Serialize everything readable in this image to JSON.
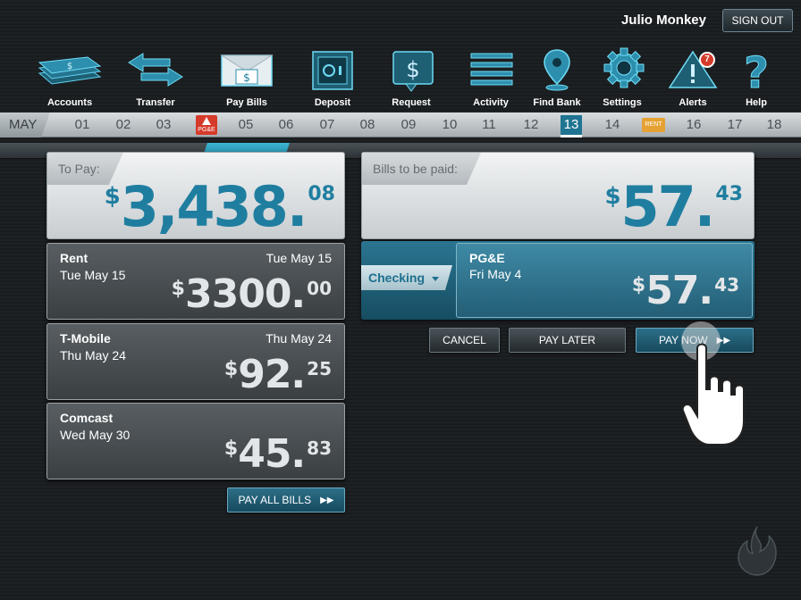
{
  "header": {
    "user_name": "Julio Monkey",
    "sign_out_label": "SIGN OUT"
  },
  "nav": {
    "items": [
      {
        "label": "Accounts",
        "icon": "money-stack-icon"
      },
      {
        "label": "Transfer",
        "icon": "transfer-arrows-icon"
      },
      {
        "label": "Pay Bills",
        "icon": "envelope-dollar-icon",
        "active": true
      },
      {
        "label": "Deposit",
        "icon": "safe-icon"
      },
      {
        "label": "Request",
        "icon": "dollar-bubble-icon"
      },
      {
        "label": "Activity",
        "icon": "list-lines-icon"
      },
      {
        "label": "Find Bank",
        "icon": "map-pin-icon"
      },
      {
        "label": "Settings",
        "icon": "gear-icon"
      },
      {
        "label": "Alerts",
        "icon": "alert-triangle-icon",
        "badge": "7"
      },
      {
        "label": "Help",
        "icon": "question-mark-icon"
      }
    ]
  },
  "calendar": {
    "month": "MAY",
    "dates": [
      "01",
      "02",
      "03",
      "04",
      "05",
      "06",
      "07",
      "08",
      "09",
      "10",
      "11",
      "12",
      "13",
      "14",
      "15",
      "16",
      "17",
      "18"
    ],
    "today": "13",
    "pge_badge": "PG&E",
    "rent_badge": "RENT"
  },
  "to_pay": {
    "label": "To Pay:",
    "currency": "$",
    "whole": "3,438.",
    "cents": "08"
  },
  "bills_to_be_paid": {
    "label": "Bills to be paid:",
    "currency": "$",
    "whole": "57.",
    "cents": "43"
  },
  "bills": [
    {
      "name": "Rent",
      "date": "Tue May 15",
      "due": "Tue May 15",
      "currency": "$",
      "whole": "3300.",
      "cents": "00"
    },
    {
      "name": "T-Mobile",
      "date": "Thu May 24",
      "due": "Thu May 24",
      "currency": "$",
      "whole": "92.",
      "cents": "25"
    },
    {
      "name": "Comcast",
      "date": "Wed May 30",
      "due": "",
      "currency": "$",
      "whole": "45.",
      "cents": "83"
    }
  ],
  "selected_bill": {
    "account": "Checking",
    "name": "PG&E",
    "date": "Fri May 4",
    "currency": "$",
    "whole": "57.",
    "cents": "43"
  },
  "actions": {
    "cancel": "CANCEL",
    "pay_later": "PAY LATER",
    "pay_now": "PAY NOW",
    "pay_all": "PAY ALL BILLS"
  },
  "colors": {
    "accent": "#1f7ea0",
    "alert_red": "#d63a2a",
    "rent_orange": "#e5a233"
  }
}
